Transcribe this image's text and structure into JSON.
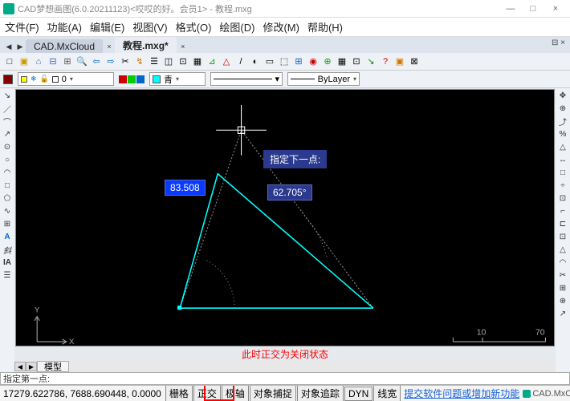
{
  "window": {
    "title": "CAD梦想画图(6.0.20211123)<哎哎的好。会员1> - 教程.mxg",
    "min": "—",
    "max": "□",
    "close": "×"
  },
  "menubar": [
    "文件(F)",
    "功能(A)",
    "编辑(E)",
    "视图(V)",
    "格式(O)",
    "绘图(D)",
    "修改(M)",
    "帮助(H)"
  ],
  "tabs": {
    "inactive": "CAD.MxCloud",
    "active": "教程.mxg*",
    "navL": "◀",
    "navR": "▶",
    "x": "×",
    "tabx": "⊟ ×"
  },
  "layerdrop": {
    "value": "0"
  },
  "colordrop": {
    "value": "青"
  },
  "linetype": {
    "value": "ByLayer"
  },
  "canvas": {
    "prompt": "指定下一点:",
    "length": "83.508",
    "angle": "62.705°",
    "axisY": "Y",
    "axisX": "X",
    "scale10": "10",
    "scale70": "70"
  },
  "redNote": "此时正交为关闭状态",
  "modeltabs": {
    "arrowL": "◀",
    "arrowR": "▶",
    "model": "模型"
  },
  "cmdline": "指定第一点:",
  "status": {
    "coords": "17279.622786,  7688.690448,  0.0000",
    "btns": [
      "栅格",
      "正交",
      "极轴",
      "对象捕捉",
      "对象追踪",
      "DYN",
      "线宽"
    ],
    "link": "提交软件问题或增加新功能",
    "brand": "CAD.MxCloud"
  },
  "lefticons": [
    "↘",
    "／",
    "⌒",
    "↗",
    "⊙",
    "○",
    "◠",
    "□",
    "⬠",
    "∿",
    "⊞",
    "A",
    "斜",
    "IA",
    "☰"
  ],
  "righticons": [
    "✥",
    "⊕",
    "⤴",
    "%",
    "△",
    "↔",
    "□",
    "÷",
    "⊡",
    "⌐",
    "⊏",
    "⊡",
    "△",
    "◠",
    "✂",
    "⊞",
    "⊕",
    "↗"
  ],
  "topicons1": [
    "□",
    "▣",
    "⌂",
    "⊟",
    "⊞",
    "🔍",
    "⇦",
    "⇨",
    "✂",
    "↯",
    "☰",
    "◫",
    "⊡",
    "▦",
    "⊿",
    "△",
    "/",
    "◐",
    "▭",
    "⬚",
    "⊞",
    "◉",
    "⊕",
    "▦",
    "⊡",
    "↘",
    "?",
    "▣",
    "⊠"
  ],
  "colorblocks": [
    "#c00",
    "#0c0",
    "#06c",
    "#cc0"
  ]
}
